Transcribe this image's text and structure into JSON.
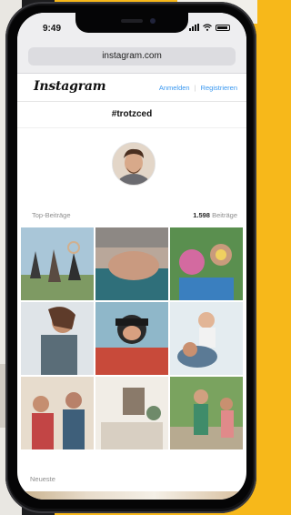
{
  "status_bar": {
    "time": "9:49"
  },
  "browser": {
    "url": "instagram.com"
  },
  "instagram": {
    "logo": "Instagram",
    "login_label": "Anmelden",
    "separator": "|",
    "register_label": "Registrieren",
    "hashtag": "#trotzced",
    "top_posts_label": "Top-Beiträge",
    "post_count": "1.598",
    "post_count_suffix": "Beiträge",
    "latest_label": "Neueste"
  },
  "colors": {
    "background": "#f7b81a",
    "link": "#3897f0",
    "muted": "#8e8e8e"
  },
  "icons": [
    "signal-icon",
    "wifi-icon",
    "battery-icon"
  ]
}
